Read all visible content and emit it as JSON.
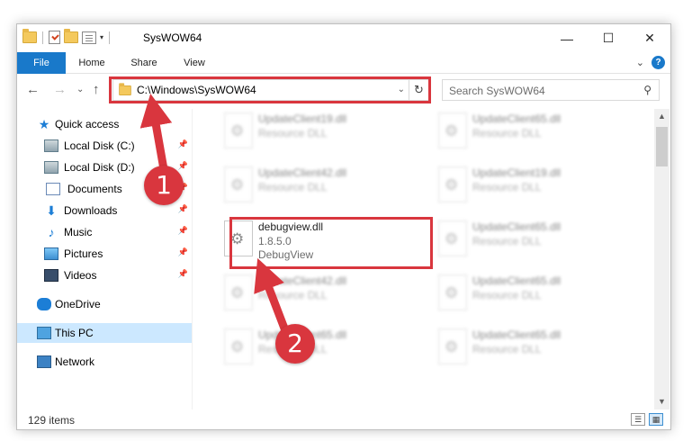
{
  "window": {
    "title": "SysWOW64",
    "controls": {
      "minimize": "—",
      "maximize": "☐",
      "close": "✕"
    }
  },
  "ribbon": {
    "tabs": [
      "File",
      "Home",
      "Share",
      "View"
    ],
    "help": "?",
    "expand": "⌄"
  },
  "navigation": {
    "back": "←",
    "forward": "→",
    "recent": "⌄",
    "up": "↑",
    "address": "C:\\Windows\\SysWOW64",
    "address_dropdown": "⌄",
    "refresh": "↻",
    "search_placeholder": "Search SysWOW64",
    "search_icon": "⚲"
  },
  "sidebar": {
    "items": [
      {
        "label": "Quick access",
        "icon": "star-icon",
        "pinned": false
      },
      {
        "label": "Local Disk (C:)",
        "icon": "disk-icon",
        "pinned": true
      },
      {
        "label": "Local Disk (D:)",
        "icon": "disk-icon",
        "pinned": true
      },
      {
        "label": "Documents",
        "icon": "documents-icon",
        "pinned": true
      },
      {
        "label": "Downloads",
        "icon": "download-icon",
        "pinned": true
      },
      {
        "label": "Music",
        "icon": "music-icon",
        "pinned": true
      },
      {
        "label": "Pictures",
        "icon": "pictures-icon",
        "pinned": true
      },
      {
        "label": "Videos",
        "icon": "videos-icon",
        "pinned": true
      },
      {
        "label": "OneDrive",
        "icon": "onedrive-icon",
        "pinned": false
      },
      {
        "label": "This PC",
        "icon": "this-pc-icon",
        "pinned": false,
        "selected": true
      },
      {
        "label": "Network",
        "icon": "network-icon",
        "pinned": false
      }
    ],
    "pin_glyph": "📌"
  },
  "files": [
    {
      "name": "UpdateClient19.dll",
      "line2": "Resource DLL",
      "line3": ""
    },
    {
      "name": "UpdateClient65.dll",
      "line2": "Resource DLL",
      "line3": ""
    },
    {
      "name": "UpdateClient42.dll",
      "line2": "Resource DLL",
      "line3": ""
    },
    {
      "name": "UpdateClient19.dll",
      "line2": "Resource DLL",
      "line3": ""
    },
    {
      "name": "debugview.dll",
      "line2": "1.8.5.0",
      "line3": "DebugView"
    },
    {
      "name": "UpdateClient65.dll",
      "line2": "Resource DLL",
      "line3": ""
    },
    {
      "name": "UpdateClient42.dll",
      "line2": "Resource DLL",
      "line3": ""
    },
    {
      "name": "UpdateClient65.dll",
      "line2": "Resource DLL",
      "line3": ""
    },
    {
      "name": "UpdateClient65.dll",
      "line2": "Resource DLL",
      "line3": ""
    },
    {
      "name": "UpdateClient65.dll",
      "line2": "Resource DLL",
      "line3": ""
    }
  ],
  "status": {
    "item_count": "129 items",
    "view_details": "☰",
    "view_tiles": "▦"
  },
  "annotations": {
    "step1": "1",
    "step2": "2",
    "color": "#d9363e"
  },
  "scrollbar": {
    "up": "▲",
    "down": "▼"
  }
}
